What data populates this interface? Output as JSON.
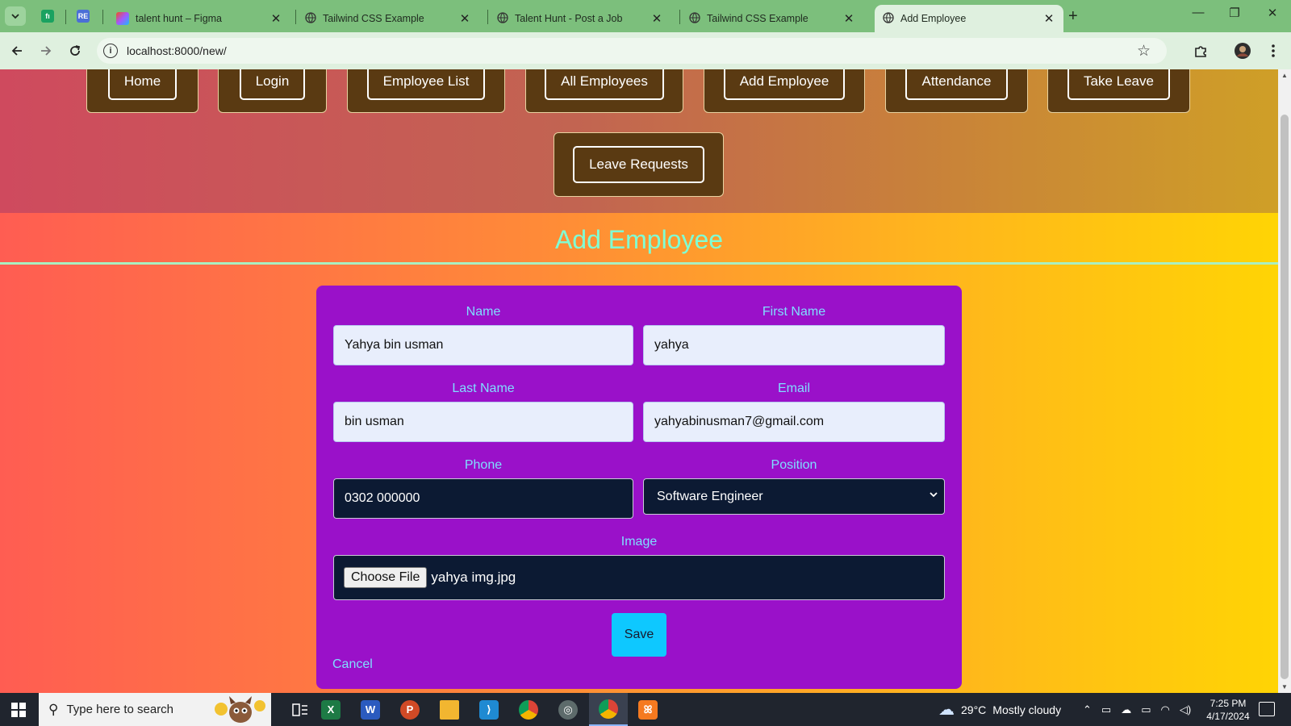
{
  "browser": {
    "tabs": [
      {
        "title": "talent hunt – Figma",
        "active": false
      },
      {
        "title": "Tailwind CSS Example",
        "active": false
      },
      {
        "title": "Talent Hunt - Post a Job",
        "active": false
      },
      {
        "title": "Tailwind CSS Example",
        "active": false
      },
      {
        "title": "Add Employee",
        "active": true
      }
    ],
    "pinned_icons": [
      "fh-icon",
      "rc-icon"
    ],
    "url": "localhost:8000/new/"
  },
  "nav": {
    "items": [
      "Home",
      "Login",
      "Employee List",
      "All Employees",
      "Add Employee",
      "Attendance",
      "Take Leave",
      "Leave Requests"
    ]
  },
  "page": {
    "title": "Add Employee"
  },
  "form": {
    "name_label": "Name",
    "name_value": "Yahya bin usman",
    "first_name_label": "First Name",
    "first_name_value": "yahya",
    "last_name_label": "Last Name",
    "last_name_value": "bin usman",
    "email_label": "Email",
    "email_value": "yahyabinusman7@gmail.com",
    "phone_label": "Phone",
    "phone_value": "0302 000000",
    "position_label": "Position",
    "position_value": "Software Engineer",
    "image_label": "Image",
    "choose_file_label": "Choose File",
    "file_name": "yahya img.jpg",
    "save_label": "Save",
    "cancel_label": "Cancel"
  },
  "taskbar": {
    "search_placeholder": "Type here to search",
    "weather_temp": "29°C",
    "weather_text": "Mostly cloudy",
    "time": "7:25 PM",
    "date": "4/17/2024"
  },
  "colors": {
    "page_gradient_start": "#ff5d52",
    "page_gradient_end": "#ffd404",
    "nav_card": "#5a3a12",
    "form_card": "#9a11c9",
    "title": "#7fffd4",
    "labels": "#7fdfff",
    "save_button": "#0ec8ff",
    "browser_frame": "#7cbf7c"
  }
}
